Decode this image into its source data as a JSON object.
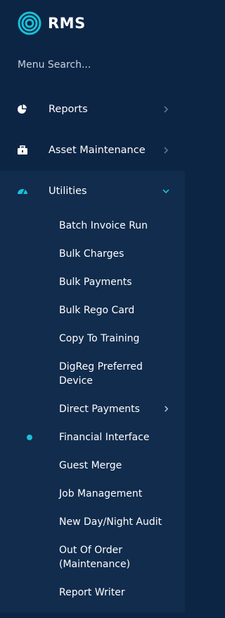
{
  "brand": {
    "name": "RMS",
    "accent": "#18c0d6"
  },
  "search": {
    "placeholder": "Menu Search..."
  },
  "menu": [
    {
      "label": "Reports",
      "icon": "pie-chart-icon"
    },
    {
      "label": "Asset Maintenance",
      "icon": "toolbox-icon"
    },
    {
      "label": "Utilities",
      "icon": "speedometer-icon",
      "expanded": true
    }
  ],
  "utilities_items": [
    "Batch Invoice Run",
    "Bulk Charges",
    "Bulk Payments",
    "Bulk Rego Card",
    "Copy To Training",
    "DigReg Preferred Device",
    "Direct Payments",
    "Financial Interface",
    "Guest Merge",
    "Job Management",
    "New Day/Night Audit",
    "Out Of Order (Maintenance)",
    "Report Writer"
  ],
  "active_item": "Financial Interface"
}
